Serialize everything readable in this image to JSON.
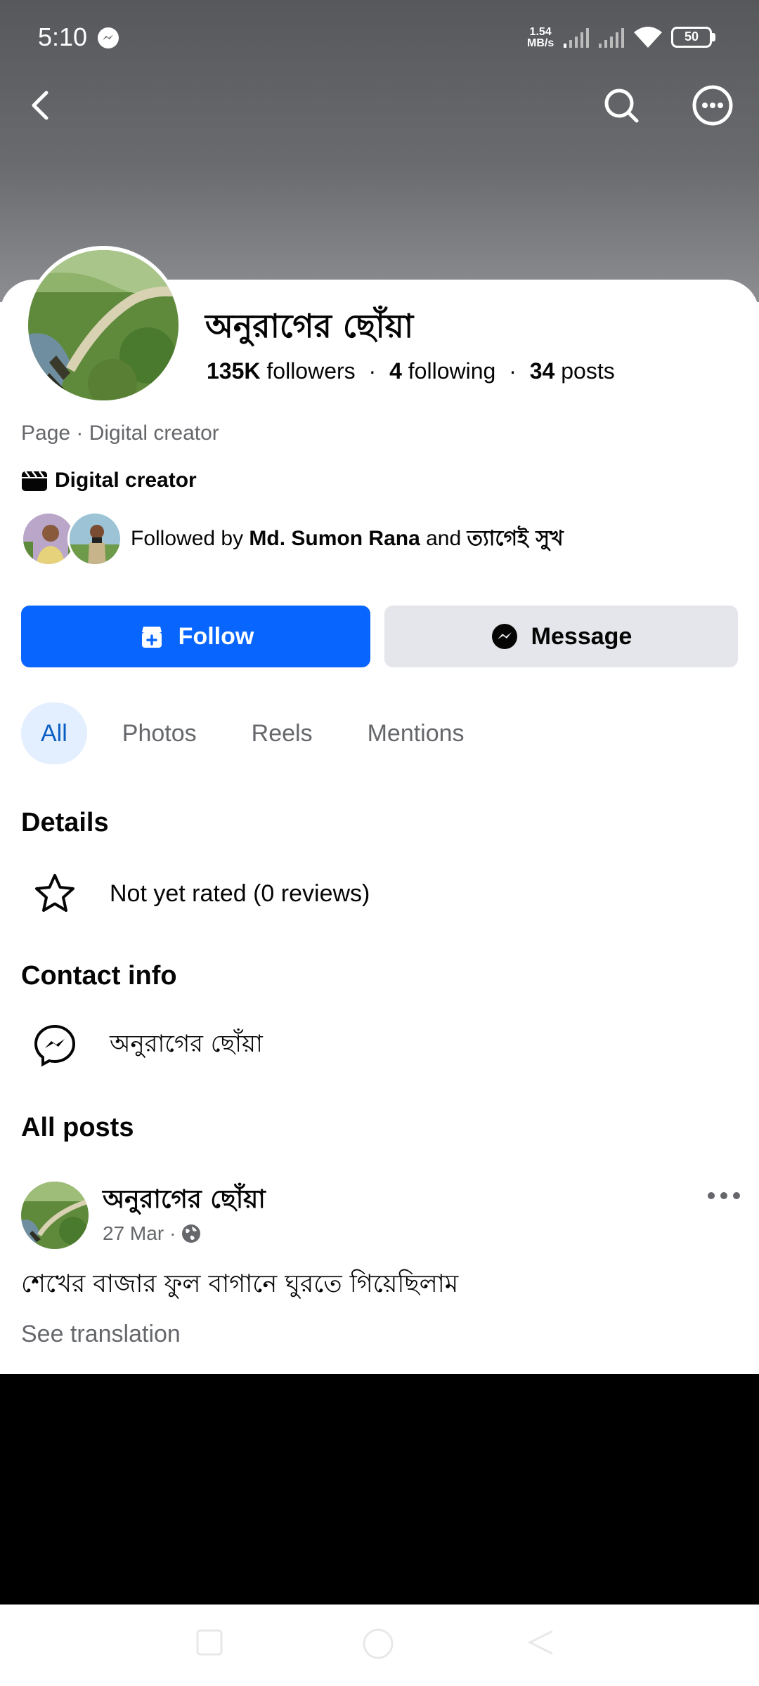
{
  "status_bar": {
    "time": "5:10",
    "speed_value": "1.54",
    "speed_unit": "MB/s",
    "battery": "50"
  },
  "header": {
    "back_icon": "arrow-left-icon",
    "search_icon": "search-icon",
    "more_icon": "more-circle-icon"
  },
  "profile": {
    "name": "অনুরাগের ছোঁয়া",
    "followers_count": "135K",
    "followers_label": "followers",
    "following_count": "4",
    "following_label": "following",
    "posts_count": "34",
    "posts_label": "posts",
    "separator": "·",
    "category_line": "Page · Digital creator",
    "creator_label": "Digital creator",
    "followed_by_prefix": "Followed by",
    "followed_by_first": "Md. Sumon Rana",
    "followed_by_and": "and",
    "followed_by_second": "ত্যাগেই সুখ"
  },
  "actions": {
    "follow_label": "Follow",
    "message_label": "Message"
  },
  "tabs": [
    {
      "label": "All",
      "active": true
    },
    {
      "label": "Photos",
      "active": false
    },
    {
      "label": "Reels",
      "active": false
    },
    {
      "label": "Mentions",
      "active": false
    }
  ],
  "details": {
    "title": "Details",
    "rating": "Not yet rated (0 reviews)"
  },
  "contact": {
    "title": "Contact info",
    "messenger": "অনুরাগের ছোঁয়া"
  },
  "posts": {
    "title": "All posts",
    "items": [
      {
        "author": "অনুরাগের ছোঁয়া",
        "date": "27 Mar",
        "dot": "·",
        "audience_icon": "globe-icon",
        "text": "শেখের বাজার ফুল বাগানে ঘুরতে গিয়েছিলাম",
        "see_translation": "See translation"
      }
    ]
  },
  "colors": {
    "accent": "#0866ff",
    "active_tab_bg": "#e3effe",
    "active_tab_text": "#0a5dc2",
    "secondary_text": "#65676b",
    "secondary_button": "#e4e6eb"
  }
}
